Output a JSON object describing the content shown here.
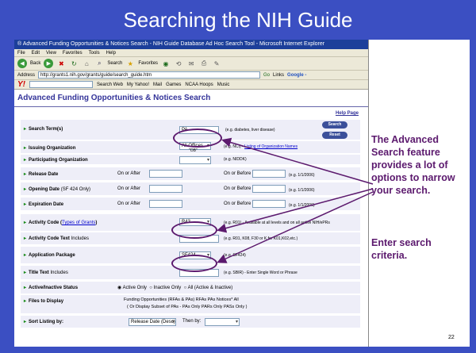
{
  "slide": {
    "title": "Searching the NIH Guide",
    "page_number": "22",
    "callout_1": "The Advanced Search feature provides a lot of options to narrow your search.",
    "callout_2": "Enter search criteria."
  },
  "browser": {
    "window_title": "® Advanced Funding Opportunities & Notices Search - NIH Guide Database Ad Hoc Search Tool - Microsoft Internet Explorer",
    "menu": [
      "File",
      "Edit",
      "View",
      "Favorites",
      "Tools",
      "Help"
    ],
    "toolbar": {
      "back": "Back",
      "search": "Search",
      "favorites": "Favorites"
    },
    "address_label": "Address",
    "address_value": "http://grants1.nih.gov/grants/guide/search_guide.htm",
    "go_label": "Go",
    "links_label": "Links",
    "google_label": "Google -",
    "yahoo_logo": "Y!",
    "yahoo_items": [
      "Search Web",
      "My Yahoo!",
      "Mail",
      "Games",
      "NCAA Hoops",
      "Music"
    ]
  },
  "page": {
    "heading": "Advanced Funding Opportunities & Notices Search",
    "help_link": "Help Page",
    "search_terms": {
      "label": "Search Term(s)",
      "value": "PA",
      "hint": "(e.g. diabetes, liver disease)"
    },
    "search_button": "Search",
    "reset_button": "Reset",
    "issuing_org": {
      "label": "Issuing Organization",
      "value": "All Offices",
      "value2": "\"OB\"",
      "hint": "(e.g. NCI) - ",
      "hint_link": "Listing of Organization Names"
    },
    "participating_org": {
      "label": "Participating Organization",
      "hint": "(e.g. NIDDK)"
    },
    "release_date": {
      "label": "Release Date",
      "on_after": "On or After",
      "on_before": "On or Before",
      "hint": "(e.g. 1/1/2006)"
    },
    "opening_date": {
      "label": "Opening Date",
      "sub": "(SF 424 Only)",
      "on_after": "On or After",
      "on_before": "On or Before",
      "hint": "(e.g. 1/1/2006)"
    },
    "expiration_date": {
      "label": "Expiration Date",
      "on_after": "On or After",
      "on_before": "On or Before",
      "hint": "(e.g. 1/1/2006)"
    },
    "activity_code": {
      "label": "Activity Code",
      "link": "Types of Grants",
      "value": "R43",
      "hint": "(e.g. R01) - Available at all levels and on all active NIH/ePRs"
    },
    "activity_code_text": {
      "label": "Activity Code Text",
      "sub": "Includes",
      "hint": "(e.g. R01, K08, F30 or K for K01,K02,etc.)"
    },
    "application_package": {
      "label": "Application Package",
      "value": "SF424",
      "hint": "(e.g. SF424)"
    },
    "title_text": {
      "label": "Title Text",
      "sub": "Includes",
      "hint": "(e.g. SBIR) - Enter Single Word or Phrase"
    },
    "status": {
      "label": "Active/Inactive Status",
      "options": [
        "Active Only",
        "Inactive Only",
        "All (Active & Inactive)"
      ]
    },
    "files": {
      "label": "Files to Display",
      "line1": "Funding Opportunities (RFAs & PAs)  RFAs  PAs  Notices*  All",
      "line2": "( Or Display Subset of PAs -  PAs Only  PARs Only  PASs Only )"
    },
    "sort": {
      "label": "Sort Listing by:",
      "value": "Release Date (Desc)",
      "then_by": "Then by:"
    }
  },
  "colors": {
    "slide_blue": "#3b4fc2",
    "callout_purple": "#5c1a6e",
    "form_row": "#eeeef8"
  }
}
